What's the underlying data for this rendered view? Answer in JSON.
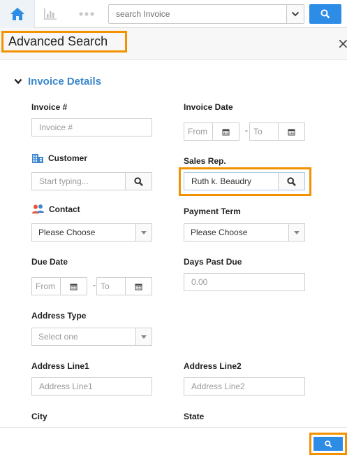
{
  "topbar": {
    "search_placeholder": "search Invoice",
    "home_icon": "home-icon",
    "chart_icon": "bar-chart-icon",
    "more_icon": "more-dots-icon",
    "search_icon": "search-icon",
    "accent": "#2d8ce6"
  },
  "header": {
    "title": "Advanced Search",
    "close_label": "×"
  },
  "section": {
    "title": "Invoice Details"
  },
  "fields": {
    "invoice_no": {
      "label": "Invoice #",
      "placeholder": "Invoice #"
    },
    "invoice_date": {
      "label": "Invoice Date",
      "from": "From",
      "to": "To",
      "dash": "-"
    },
    "customer": {
      "label": "Customer",
      "placeholder": "Start typing..."
    },
    "sales_rep": {
      "label": "Sales Rep.",
      "value": "Ruth k. Beaudry"
    },
    "contact": {
      "label": "Contact",
      "value": "Please Choose"
    },
    "payment_term": {
      "label": "Payment Term",
      "value": "Please Choose"
    },
    "due_date": {
      "label": "Due Date",
      "from": "From",
      "to": "To",
      "dash": "-"
    },
    "days_past_due": {
      "label": "Days Past Due",
      "placeholder": "0.00"
    },
    "address_type": {
      "label": "Address Type",
      "value": "Select one"
    },
    "address_line1": {
      "label": "Address Line1",
      "placeholder": "Address Line1"
    },
    "address_line2": {
      "label": "Address Line2",
      "placeholder": "Address Line2"
    },
    "city": {
      "label": "City"
    },
    "state": {
      "label": "State"
    }
  },
  "colors": {
    "highlight": "#f39200",
    "section_title": "#3a86cc"
  }
}
